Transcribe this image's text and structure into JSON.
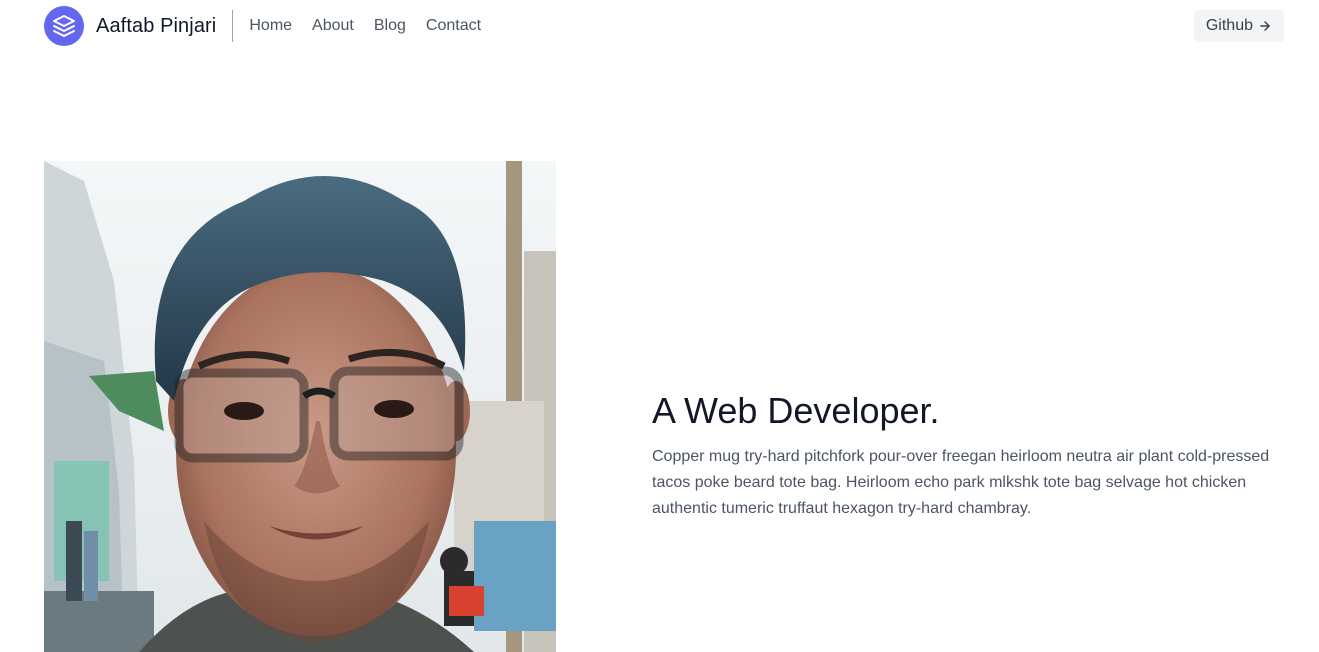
{
  "header": {
    "brand_name": "Aaftab Pinjari",
    "nav": [
      {
        "label": "Home"
      },
      {
        "label": "About"
      },
      {
        "label": "Blog"
      },
      {
        "label": "Contact"
      }
    ],
    "github_label": "Github"
  },
  "hero": {
    "image_alt": "Portrait photo",
    "title": "A Web Developer.",
    "description": "Copper mug try-hard pitchfork pour-over freegan heirloom neutra air plant cold-pressed tacos poke beard tote bag. Heirloom echo park mlkshk tote bag selvage hot chicken authentic tumeric truffaut hexagon try-hard chambray."
  },
  "colors": {
    "accent": "#6366f1",
    "title": "#111827",
    "body_text": "#4b5563",
    "button_bg": "#f3f4f6"
  },
  "icons": {
    "logo": "layers-icon",
    "github_arrow": "arrow-right-icon"
  }
}
